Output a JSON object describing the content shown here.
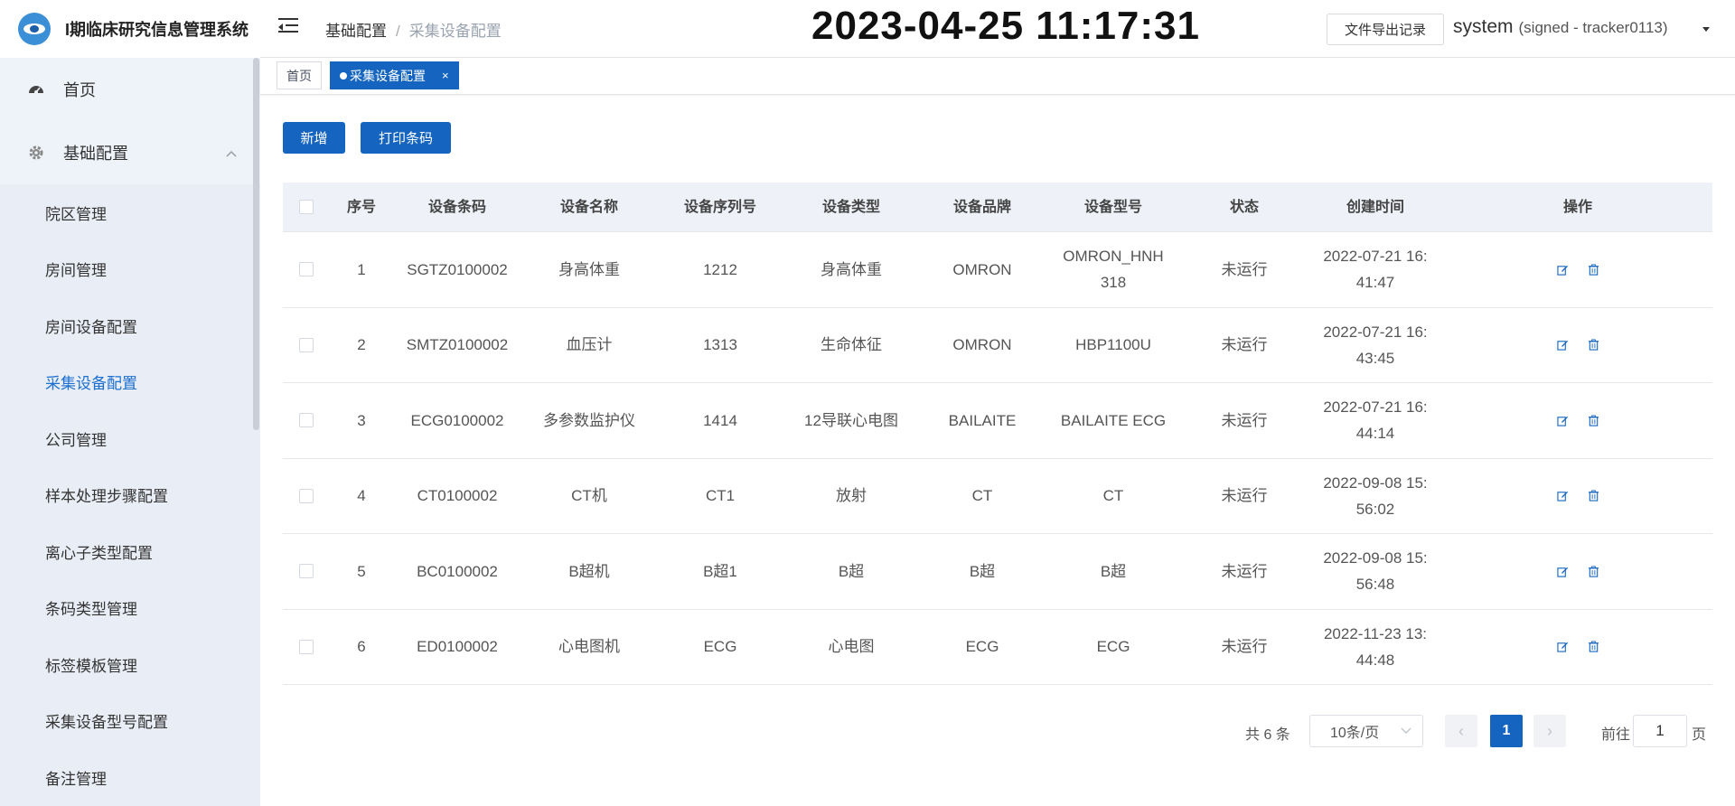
{
  "app": {
    "title": "I期临床研究信息管理系统"
  },
  "sidebar": {
    "home": "首页",
    "group": "基础配置",
    "items": [
      {
        "label": "院区管理",
        "active": false
      },
      {
        "label": "房间管理",
        "active": false
      },
      {
        "label": "房间设备配置",
        "active": false
      },
      {
        "label": "采集设备配置",
        "active": true
      },
      {
        "label": "公司管理",
        "active": false
      },
      {
        "label": "样本处理步骤配置",
        "active": false
      },
      {
        "label": "离心子类型配置",
        "active": false
      },
      {
        "label": "条码类型管理",
        "active": false
      },
      {
        "label": "标签模板管理",
        "active": false
      },
      {
        "label": "采集设备型号配置",
        "active": false
      },
      {
        "label": "备注管理",
        "active": false
      }
    ]
  },
  "header": {
    "breadcrumb": [
      "基础配置",
      "采集设备配置"
    ],
    "breadcrumb_sep": "/",
    "clock": "2023-04-25 11:17:31",
    "export_label": "文件导出记录",
    "user": "system",
    "user_signed": "(signed - tracker0113)"
  },
  "tabs": {
    "home": "首页",
    "current": "采集设备配置",
    "close": "×"
  },
  "toolbar": {
    "add_label": "新增",
    "print_label": "打印条码"
  },
  "table": {
    "columns": [
      "序号",
      "设备条码",
      "设备名称",
      "设备序列号",
      "设备类型",
      "设备品牌",
      "设备型号",
      "状态",
      "创建时间",
      "操作"
    ],
    "rows": [
      {
        "idx": "1",
        "code": "SGTZ0100002",
        "name": "身高体重",
        "serial": "1212",
        "type": "身高体重",
        "brand": "OMRON",
        "model": "OMRON_HNH\n318",
        "status": "未运行",
        "created": "2022-07-21 16:\n41:47"
      },
      {
        "idx": "2",
        "code": "SMTZ0100002",
        "name": "血压计",
        "serial": "1313",
        "type": "生命体征",
        "brand": "OMRON",
        "model": "HBP1100U",
        "status": "未运行",
        "created": "2022-07-21 16:\n43:45"
      },
      {
        "idx": "3",
        "code": "ECG0100002",
        "name": "多参数监护仪",
        "serial": "1414",
        "type": "12导联心电图",
        "brand": "BAILAITE",
        "model": "BAILAITE ECG",
        "status": "未运行",
        "created": "2022-07-21 16:\n44:14"
      },
      {
        "idx": "4",
        "code": "CT0100002",
        "name": "CT机",
        "serial": "CT1",
        "type": "放射",
        "brand": "CT",
        "model": "CT",
        "status": "未运行",
        "created": "2022-09-08 15:\n56:02"
      },
      {
        "idx": "5",
        "code": "BC0100002",
        "name": "B超机",
        "serial": "B超1",
        "type": "B超",
        "brand": "B超",
        "model": "B超",
        "status": "未运行",
        "created": "2022-09-08 15:\n56:48"
      },
      {
        "idx": "6",
        "code": "ED0100002",
        "name": "心电图机",
        "serial": "ECG",
        "type": "心电图",
        "brand": "ECG",
        "model": "ECG",
        "status": "未运行",
        "created": "2022-11-23 13:\n44:48"
      }
    ],
    "ops_icons": [
      "edit-icon",
      "delete-icon"
    ]
  },
  "pagination": {
    "total": "共 6 条",
    "page_size": "10条/页",
    "current_page": "1",
    "goto_label": "前往",
    "goto_value": "1",
    "goto_unit": "页"
  },
  "colors": {
    "primary": "#1565c0",
    "active_menu": "#1b6fd1",
    "sidebar_bg": "#eef2f9",
    "table_head_bg": "#eef2f8"
  }
}
